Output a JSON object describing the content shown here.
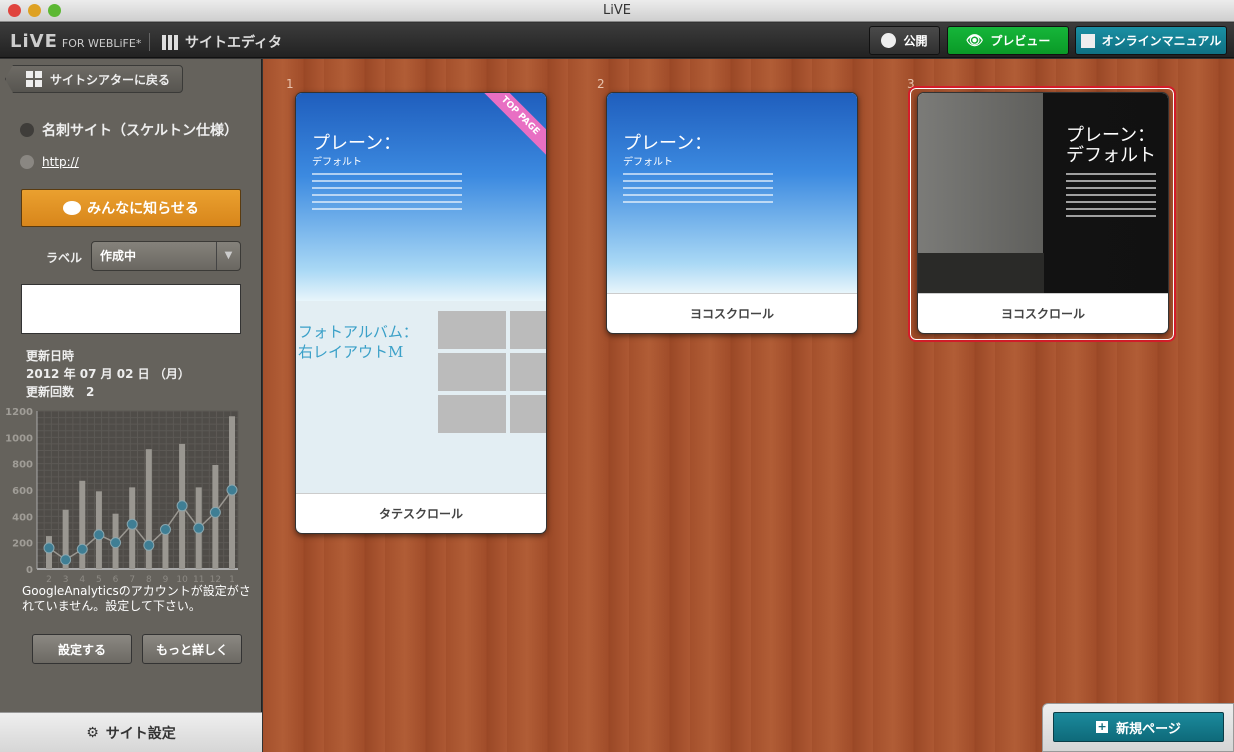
{
  "window": {
    "title": "LiVE"
  },
  "toolbar": {
    "logo": "LiVE",
    "logo_sub": "FOR WEBLiFE*",
    "editor_title": "サイトエディタ",
    "publish": "公開",
    "preview": "プレビュー",
    "manual": "オンラインマニュアル",
    "colors": {
      "preview": "#0ea12e",
      "manual": "#157f92"
    }
  },
  "sidebar": {
    "back": "サイトシアターに戻る",
    "site_name": "名刺サイト（スケルトン仕様）",
    "url": "http://",
    "share": "みんなに知らせる",
    "label_caption": "ラベル",
    "label_value": "作成中",
    "memo": "",
    "updated_label": "更新日時",
    "updated_value": "2012 年 07 月 02 日 （月）",
    "count_label": "更新回数",
    "count_value": "2",
    "ga_message": "GoogleAnalyticsのアカウントが設定がされていません。設定して下さい。",
    "setup": "設定する",
    "details": "もっと詳しく",
    "site_settings": "サイト設定"
  },
  "chart_data": {
    "type": "bar+line",
    "categories": [
      "2",
      "3",
      "4",
      "5",
      "6",
      "7",
      "8",
      "9",
      "10",
      "11",
      "12",
      "1"
    ],
    "yticks": [
      "0",
      "200",
      "400",
      "600",
      "800",
      "1000",
      "1200"
    ],
    "ylim": [
      0,
      1200
    ],
    "grid": true,
    "series": [
      {
        "type": "bar",
        "values": [
          250,
          450,
          670,
          590,
          420,
          620,
          910,
          300,
          950,
          620,
          790,
          1160
        ]
      },
      {
        "type": "line",
        "values": [
          160,
          70,
          150,
          260,
          200,
          340,
          180,
          300,
          480,
          310,
          430,
          600
        ]
      }
    ]
  },
  "pages": [
    {
      "number": "1",
      "caption": "タテスクロール",
      "badge": "TOP PAGE",
      "title": "プレーン：",
      "subtitle": "デフォルト",
      "title2": "フォトアルバム：",
      "subtitle2": "右レイアウトM"
    },
    {
      "number": "2",
      "caption": "ヨコスクロール",
      "title": "プレーン：",
      "subtitle": "デフォルト"
    },
    {
      "number": "3",
      "caption": "ヨコスクロール",
      "title": "プレーン：",
      "subtitle": "デフォルト",
      "selected": true
    }
  ],
  "new_page": "新規ページ"
}
